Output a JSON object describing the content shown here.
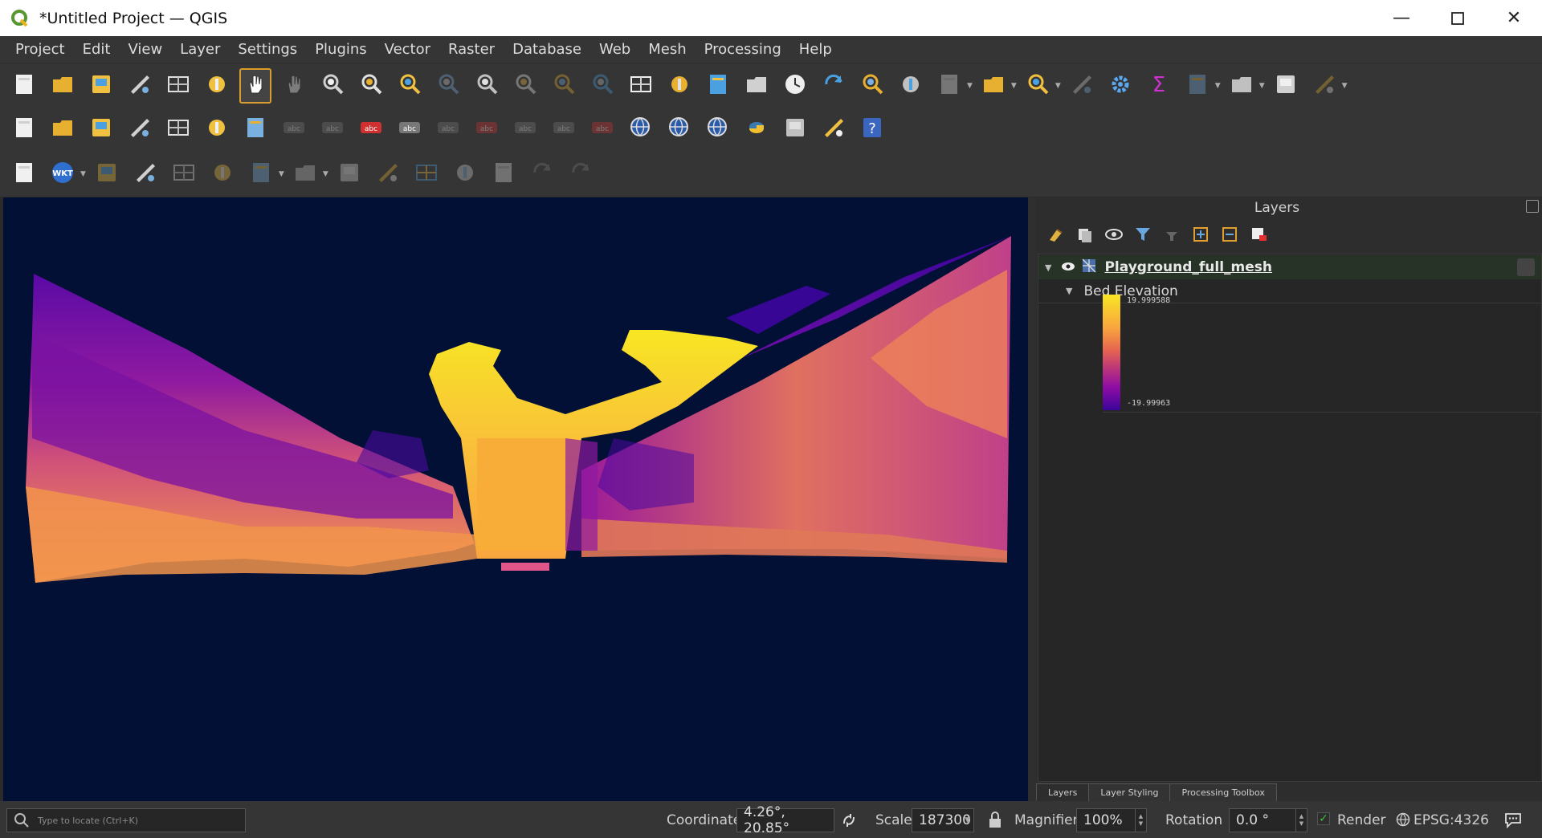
{
  "window": {
    "title": "*Untitled Project — QGIS"
  },
  "menu": [
    "Project",
    "Edit",
    "View",
    "Layer",
    "Settings",
    "Plugins",
    "Vector",
    "Raster",
    "Database",
    "Web",
    "Mesh",
    "Processing",
    "Help"
  ],
  "toolbar_row1": [
    "new-project-icon",
    "open-project-icon",
    "save-project-icon",
    "save-as-icon",
    "print-layout-icon",
    "style-manager-icon",
    "pan-icon",
    "pan-to-selection-icon",
    "zoom-in-icon",
    "zoom-out-icon",
    "zoom-full-icon",
    "zoom-to-selection-icon",
    "zoom-to-layer-icon",
    "zoom-native-icon",
    "zoom-last-icon",
    "zoom-next-icon",
    "new-bookmark-icon",
    "new-map-view-icon",
    "new-3d-view-icon",
    "show-bookmarks-icon",
    "temporal-controller-icon",
    "refresh-icon",
    "identify-feature-icon",
    "open-attribute-table-icon",
    "deselect-all-icon",
    "select-by-location-icon",
    "identify-icon",
    "statistics-grid-icon",
    "settings-gear-icon",
    "sum-icon",
    "attribute-table-icon",
    "measure-icon",
    "map-tips-icon",
    "run-macro-icon"
  ],
  "toolbar_row2": [
    "add-vector-layer-icon",
    "add-raster-layer-icon",
    "add-point-icon",
    "digitize-icon",
    "add-line-icon",
    "add-grid-icon",
    "add-mesh-icon",
    "label-tool-icon",
    "label-pin-icon",
    "label-highlight-icon",
    "label-red-icon",
    "label-move-icon",
    "label-rotate-icon",
    "label-change-icon",
    "label-show-icon",
    "label-abc-icon",
    "wms-icon",
    "wfs-icon",
    "web-globe-icon",
    "python-icon",
    "layer-stack-icon",
    "wkt-icon",
    "help-icon"
  ],
  "toolbar_row3": [
    "text-annotation-icon",
    "wkt-badge-icon",
    "edit-pencil-icon",
    "toggle-edit-icon",
    "save-edits-icon",
    "digitize-line-icon",
    "add-vertices-icon",
    "vertex-tool-icon",
    "modify-attributes-icon",
    "delete-selected-icon",
    "cut-features-icon",
    "copy-features-icon",
    "paste-features-icon",
    "undo-icon",
    "redo-icon"
  ],
  "panel": {
    "title": "Layers",
    "layer_name": "Playground_full_mesh",
    "group_name": "Bed Elevation",
    "legend_max": "19.999588",
    "legend_min": "-19.99963",
    "tabs": [
      "Layers",
      "Layer Styling",
      "Processing Toolbox"
    ]
  },
  "colors": {
    "canvas_bg": "#031036",
    "ui_bg": "#353535",
    "accent_active": "#d89d2b",
    "ramp": [
      "#f8e623",
      "#f9a73e",
      "#e6654f",
      "#c13b75",
      "#8f0da4",
      "#3b049a"
    ]
  },
  "status": {
    "locate_placeholder": "Type to locate (Ctrl+K)",
    "coordinate_label": "Coordinate",
    "coordinate_value": "4.26°, 20.85°",
    "scale_label": "Scale",
    "scale_value": "187300",
    "magnifier_label": "Magnifier",
    "magnifier_value": "100%",
    "rotation_label": "Rotation",
    "rotation_value": "0.0 °",
    "render_label": "Render",
    "crs": "EPSG:4326"
  }
}
